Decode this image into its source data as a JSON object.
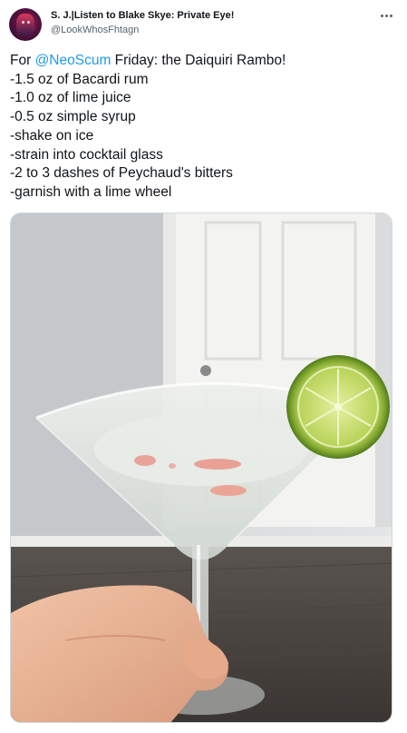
{
  "tweet": {
    "author": {
      "display_name": "S. J.|Listen to Blake Skye: Private Eye!",
      "handle": "@LookWhosFhtagn",
      "avatar_icon": "avatar-portrait"
    },
    "more_icon": "more-horizontal-icon",
    "text": {
      "intro_prefix": "For ",
      "mention": "@NeoScum",
      "intro_suffix": " Friday: the Daiquiri Rambo!",
      "lines": [
        "-1.5 oz of Bacardi rum",
        "-1.0 oz of lime juice",
        "-0.5 oz simple syrup",
        "-shake on ice",
        "-strain into cocktail glass",
        "-2 to 3 dashes of Peychaud's bitters",
        "-garnish with a lime wheel"
      ]
    },
    "media": {
      "type": "photo",
      "subject": "martini glass with pale daiquiri, lime wheel garnish, bitters dashes, hand holding stem, white door background"
    },
    "colors": {
      "link": "#1d9bf0",
      "text": "#0f1419",
      "secondary": "#536471",
      "border": "#cfd9de"
    }
  }
}
